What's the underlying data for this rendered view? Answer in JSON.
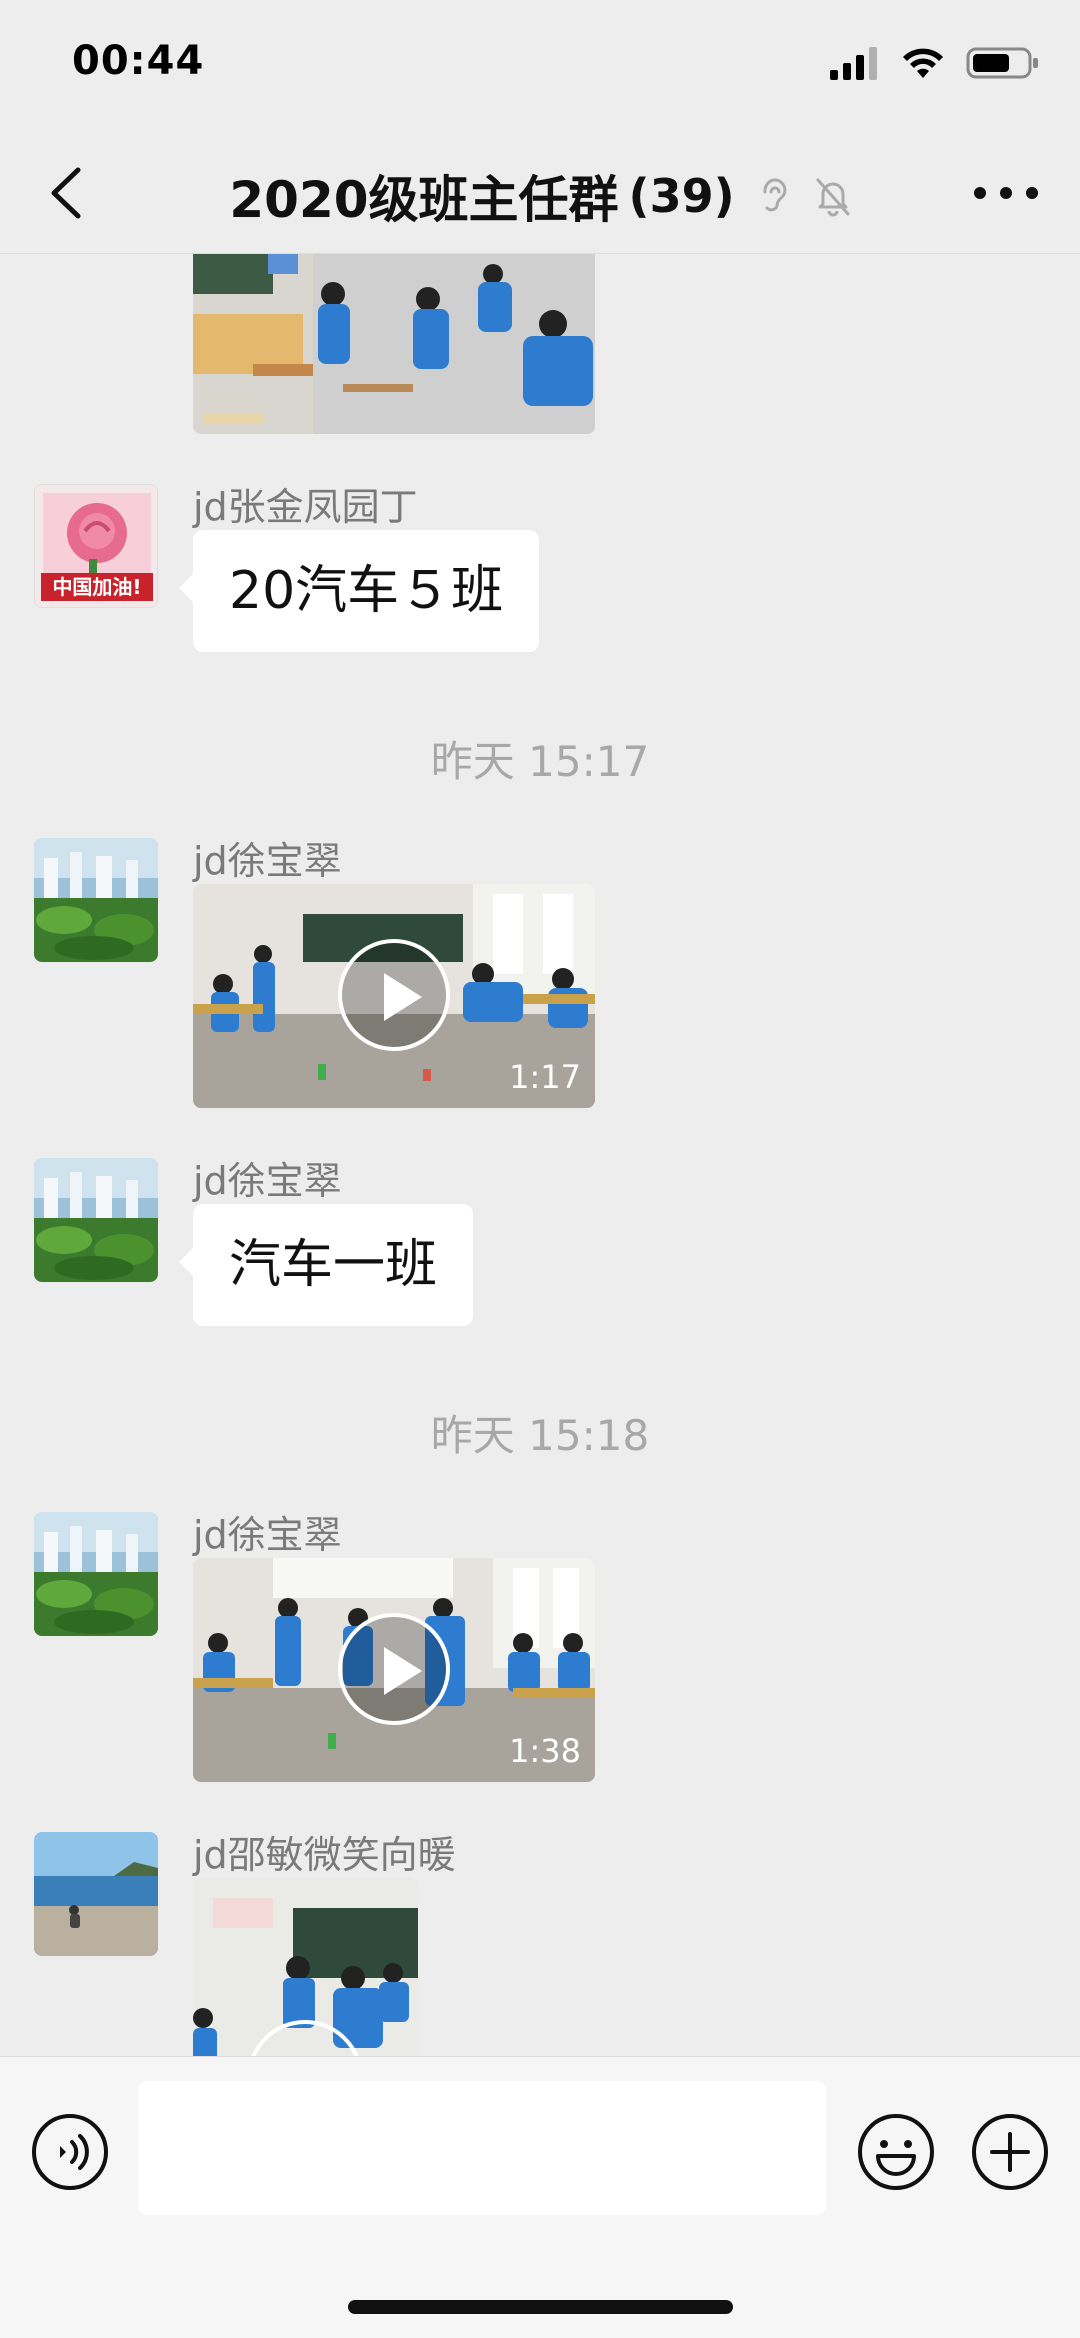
{
  "status_bar": {
    "time": "00:44"
  },
  "header": {
    "title": "2020级班主任群",
    "member_count": "(39)",
    "back_icon": "chevron-left-icon",
    "ear_icon": "ear-icon",
    "mute_icon": "bell-off-icon",
    "more_icon": "more-icon"
  },
  "messages": [
    {
      "type": "image",
      "caption": ""
    },
    {
      "sender": "jd张金凤园丁",
      "type": "text",
      "text": "20汽车５班"
    },
    {
      "timestamp": "昨天 15:17"
    },
    {
      "sender": "jd徐宝翠",
      "type": "video",
      "duration": "1:17"
    },
    {
      "sender": "jd徐宝翠",
      "type": "text",
      "text": "汽车一班"
    },
    {
      "timestamp": "昨天 15:18"
    },
    {
      "sender": "jd徐宝翠",
      "type": "video",
      "duration": "1:38"
    },
    {
      "sender": "jd邵敏微笑向暖",
      "type": "video"
    }
  ],
  "avatar_badge": "中国加油!",
  "input_bar": {
    "placeholder": "",
    "voice_icon": "voice-icon",
    "emoji_icon": "emoji-icon",
    "plus_icon": "plus-icon"
  },
  "colors": {
    "background": "#ededed",
    "bubble": "#ffffff",
    "timestamp": "#a8a8a8",
    "sender": "#7a7a7a"
  }
}
